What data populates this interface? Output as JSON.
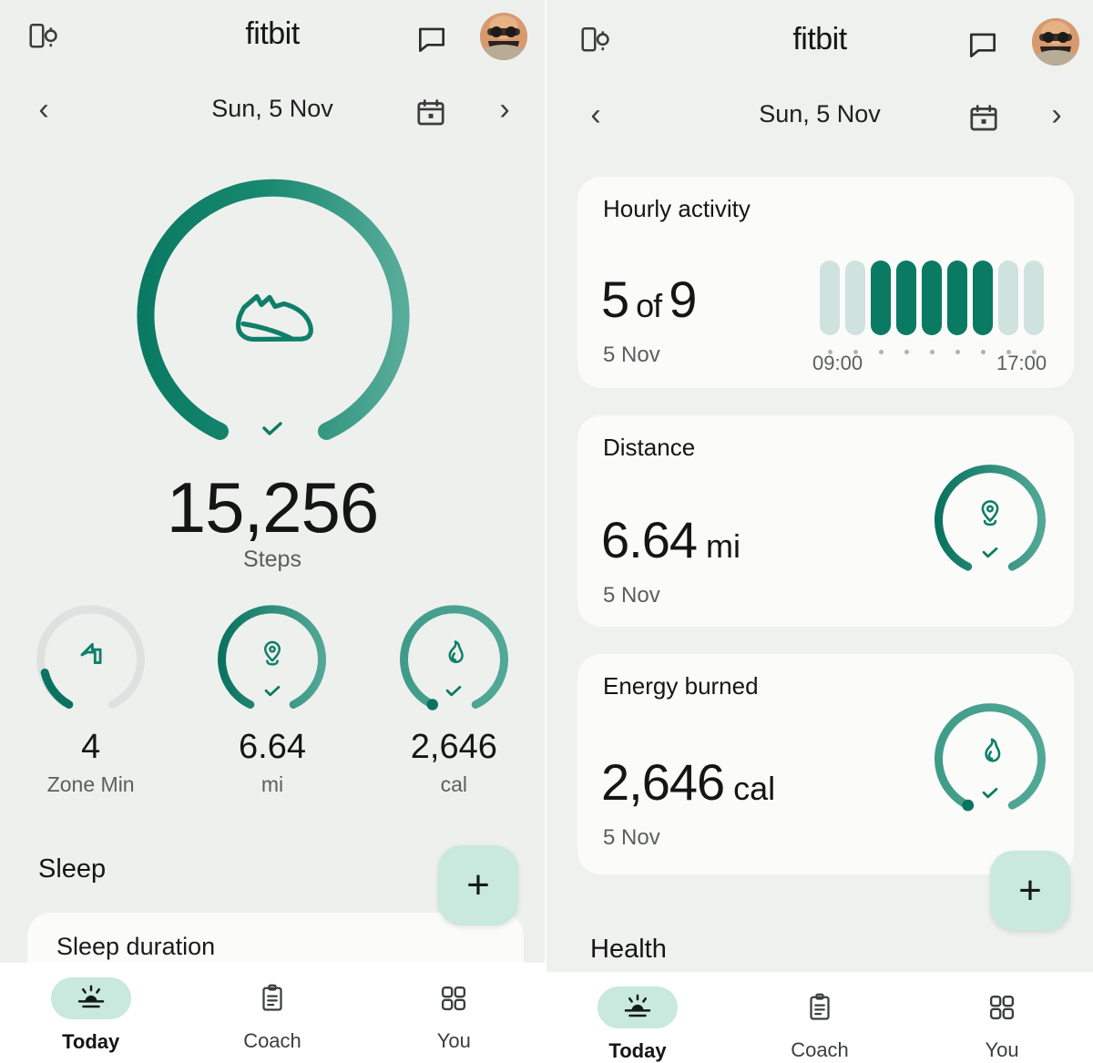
{
  "colors": {
    "bg": "#eef0ee",
    "card": "#fbfbfa",
    "dark_green": "#0a7a63",
    "mid_green": "#1c8a71",
    "light_green": "#4fa695",
    "pale_green": "#cfe2dd",
    "mint": "#c9e8de",
    "track": "#dde2e0",
    "text": "#151515",
    "muted": "#5a5f5d"
  },
  "header": {
    "brand": "fitbit",
    "devices_icon": "devices-icon",
    "chat_icon": "chat-bubble-icon",
    "avatar": "user-avatar"
  },
  "datebar": {
    "prev": "‹",
    "next": "›",
    "date": "Sun, 5 Nov",
    "calendar_icon": "calendar-icon"
  },
  "left": {
    "steps": {
      "icon": "shoe-icon",
      "value": "15,256",
      "label": "Steps",
      "goal_met": true,
      "progress_pct": 100
    },
    "metrics": [
      {
        "icon": "zone-minutes-icon",
        "value": "4",
        "unit": "Zone Min",
        "progress_pct": 13,
        "goal_met": false
      },
      {
        "icon": "location-pin-icon",
        "value": "6.64",
        "unit": "mi",
        "progress_pct": 100,
        "goal_met": true
      },
      {
        "icon": "flame-icon",
        "value": "2,646",
        "unit": "cal",
        "progress_pct": 100,
        "goal_met": true
      }
    ],
    "sleep_section": "Sleep",
    "sleep_card_title": "Sleep duration",
    "fab_label": "+"
  },
  "right": {
    "hourly": {
      "title": "Hourly activity",
      "value": "5",
      "of": "of",
      "goal": "9",
      "date": "5 Nov",
      "tick_start": "09:00",
      "tick_end": "17:00"
    },
    "distance": {
      "title": "Distance",
      "value": "6.64",
      "unit": "mi",
      "date": "5 Nov",
      "icon": "location-pin-icon",
      "goal_met": true
    },
    "energy": {
      "title": "Energy burned",
      "value": "2,646",
      "unit": "cal",
      "date": "5 Nov",
      "icon": "flame-icon",
      "goal_met": true
    },
    "health_section": "Health",
    "fab_label": "+"
  },
  "chart_data": {
    "type": "bar",
    "title": "Hourly activity",
    "categories": [
      "09:00",
      "10:00",
      "11:00",
      "12:00",
      "13:00",
      "14:00",
      "15:00",
      "16:00",
      "17:00"
    ],
    "values": [
      0,
      0,
      1,
      1,
      1,
      1,
      1,
      0,
      0
    ],
    "states": [
      "inactive",
      "inactive",
      "active",
      "active",
      "active",
      "active",
      "active",
      "inactive",
      "inactive"
    ],
    "xlabel": "",
    "ylabel": "",
    "legend": [],
    "grid": false,
    "summary": "5 of 9"
  },
  "nav": {
    "items": [
      {
        "label": "Today",
        "icon": "sunrise-icon",
        "active": true
      },
      {
        "label": "Coach",
        "icon": "clipboard-icon",
        "active": false
      },
      {
        "label": "You",
        "icon": "grid-icon",
        "active": false
      }
    ]
  }
}
